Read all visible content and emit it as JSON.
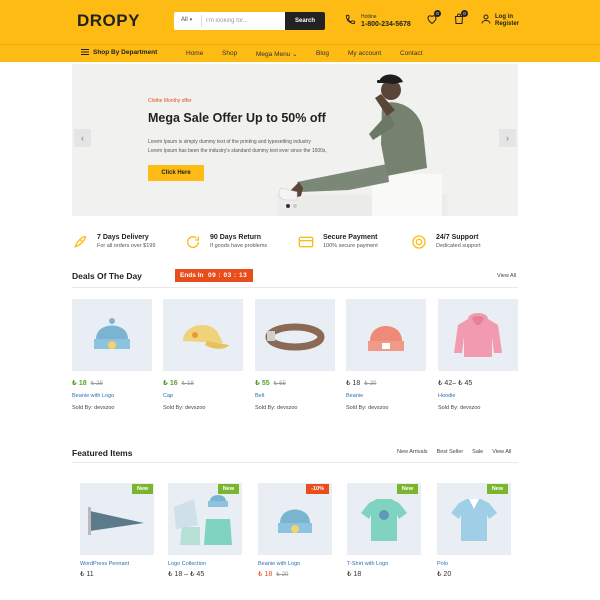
{
  "header": {
    "logo": "DROPY",
    "search": {
      "category": "All",
      "placeholder": "I'm looking for...",
      "button": "Search"
    },
    "hotline": {
      "label": "Hotline",
      "number": "1-800-234-5678"
    },
    "wishlist_count": "0",
    "cart_count": "0",
    "account": {
      "login": "Log in",
      "register": "Register"
    }
  },
  "nav": {
    "department": "Shop By Department",
    "items": [
      "Home",
      "Shop",
      "Mega Menu",
      "Blog",
      "My account",
      "Contact"
    ]
  },
  "hero": {
    "tag": "Clothe Monthy offer",
    "title": "Mega Sale Offer Up to 50% off",
    "desc_line1": "Lorem Ipsum is simply dummy text of the printing and typesetting industry",
    "desc_line2": "Lorem Ipsum has been the industry's standard dummy text ever since the 1500s,",
    "button": "Click Here",
    "prev_arrow": "‹",
    "next_arrow": "›"
  },
  "features": [
    {
      "title": "7 Days Delivery",
      "subtitle": "For all orders over $199",
      "icon": "rocket-icon"
    },
    {
      "title": "90 Days Return",
      "subtitle": "If goods have problems",
      "icon": "refresh-icon"
    },
    {
      "title": "Secure Payment",
      "subtitle": "100% secure payment",
      "icon": "credit-card-icon"
    },
    {
      "title": "24/7 Support",
      "subtitle": "Dedicated support",
      "icon": "lifebuoy-icon"
    }
  ],
  "deals": {
    "title": "Deals Of The Day",
    "ends_label": "Ends In",
    "timer": "09 : 03 : 13",
    "view_all": "View All",
    "products": [
      {
        "price": "18",
        "old": "25",
        "name": "Beanie with Logo",
        "sold_by": "Sold By: devszoo"
      },
      {
        "price": "16",
        "old": "18",
        "name": "Cap",
        "sold_by": "Sold By: devszoo"
      },
      {
        "price": "55",
        "old": "65",
        "name": "Belt",
        "sold_by": "Sold By: devszoo"
      },
      {
        "price": "18",
        "old": "20",
        "name": "Beanie",
        "sold_by": "Sold By: devszoo"
      },
      {
        "price": "42–",
        "price2": "45",
        "name": "Hoodie",
        "sold_by": "Sold By: devszoo"
      }
    ]
  },
  "featured": {
    "title": "Featured Items",
    "tabs": [
      "New Arrivals",
      "Best Seller",
      "Sale",
      "View All"
    ],
    "products": [
      {
        "badge": "New",
        "name": "WordPress Pennant",
        "price": "11"
      },
      {
        "badge": "New",
        "name": "Logo Collection",
        "price": "18 –",
        "price2": "45"
      },
      {
        "badge": "-10%",
        "name": "Beanie with Logo",
        "price": "18",
        "old": "20"
      },
      {
        "badge": "New",
        "name": "T-Shirt with Logo",
        "price": "18"
      },
      {
        "badge": "New",
        "name": "Polo",
        "price": "20"
      }
    ]
  },
  "currency_symbol": "₺",
  "colors": {
    "accent": "#fdbb14",
    "sale": "#e84d1c",
    "price": "#5aa02c",
    "link": "#2a6fb5",
    "new_badge": "#7bb52e"
  }
}
